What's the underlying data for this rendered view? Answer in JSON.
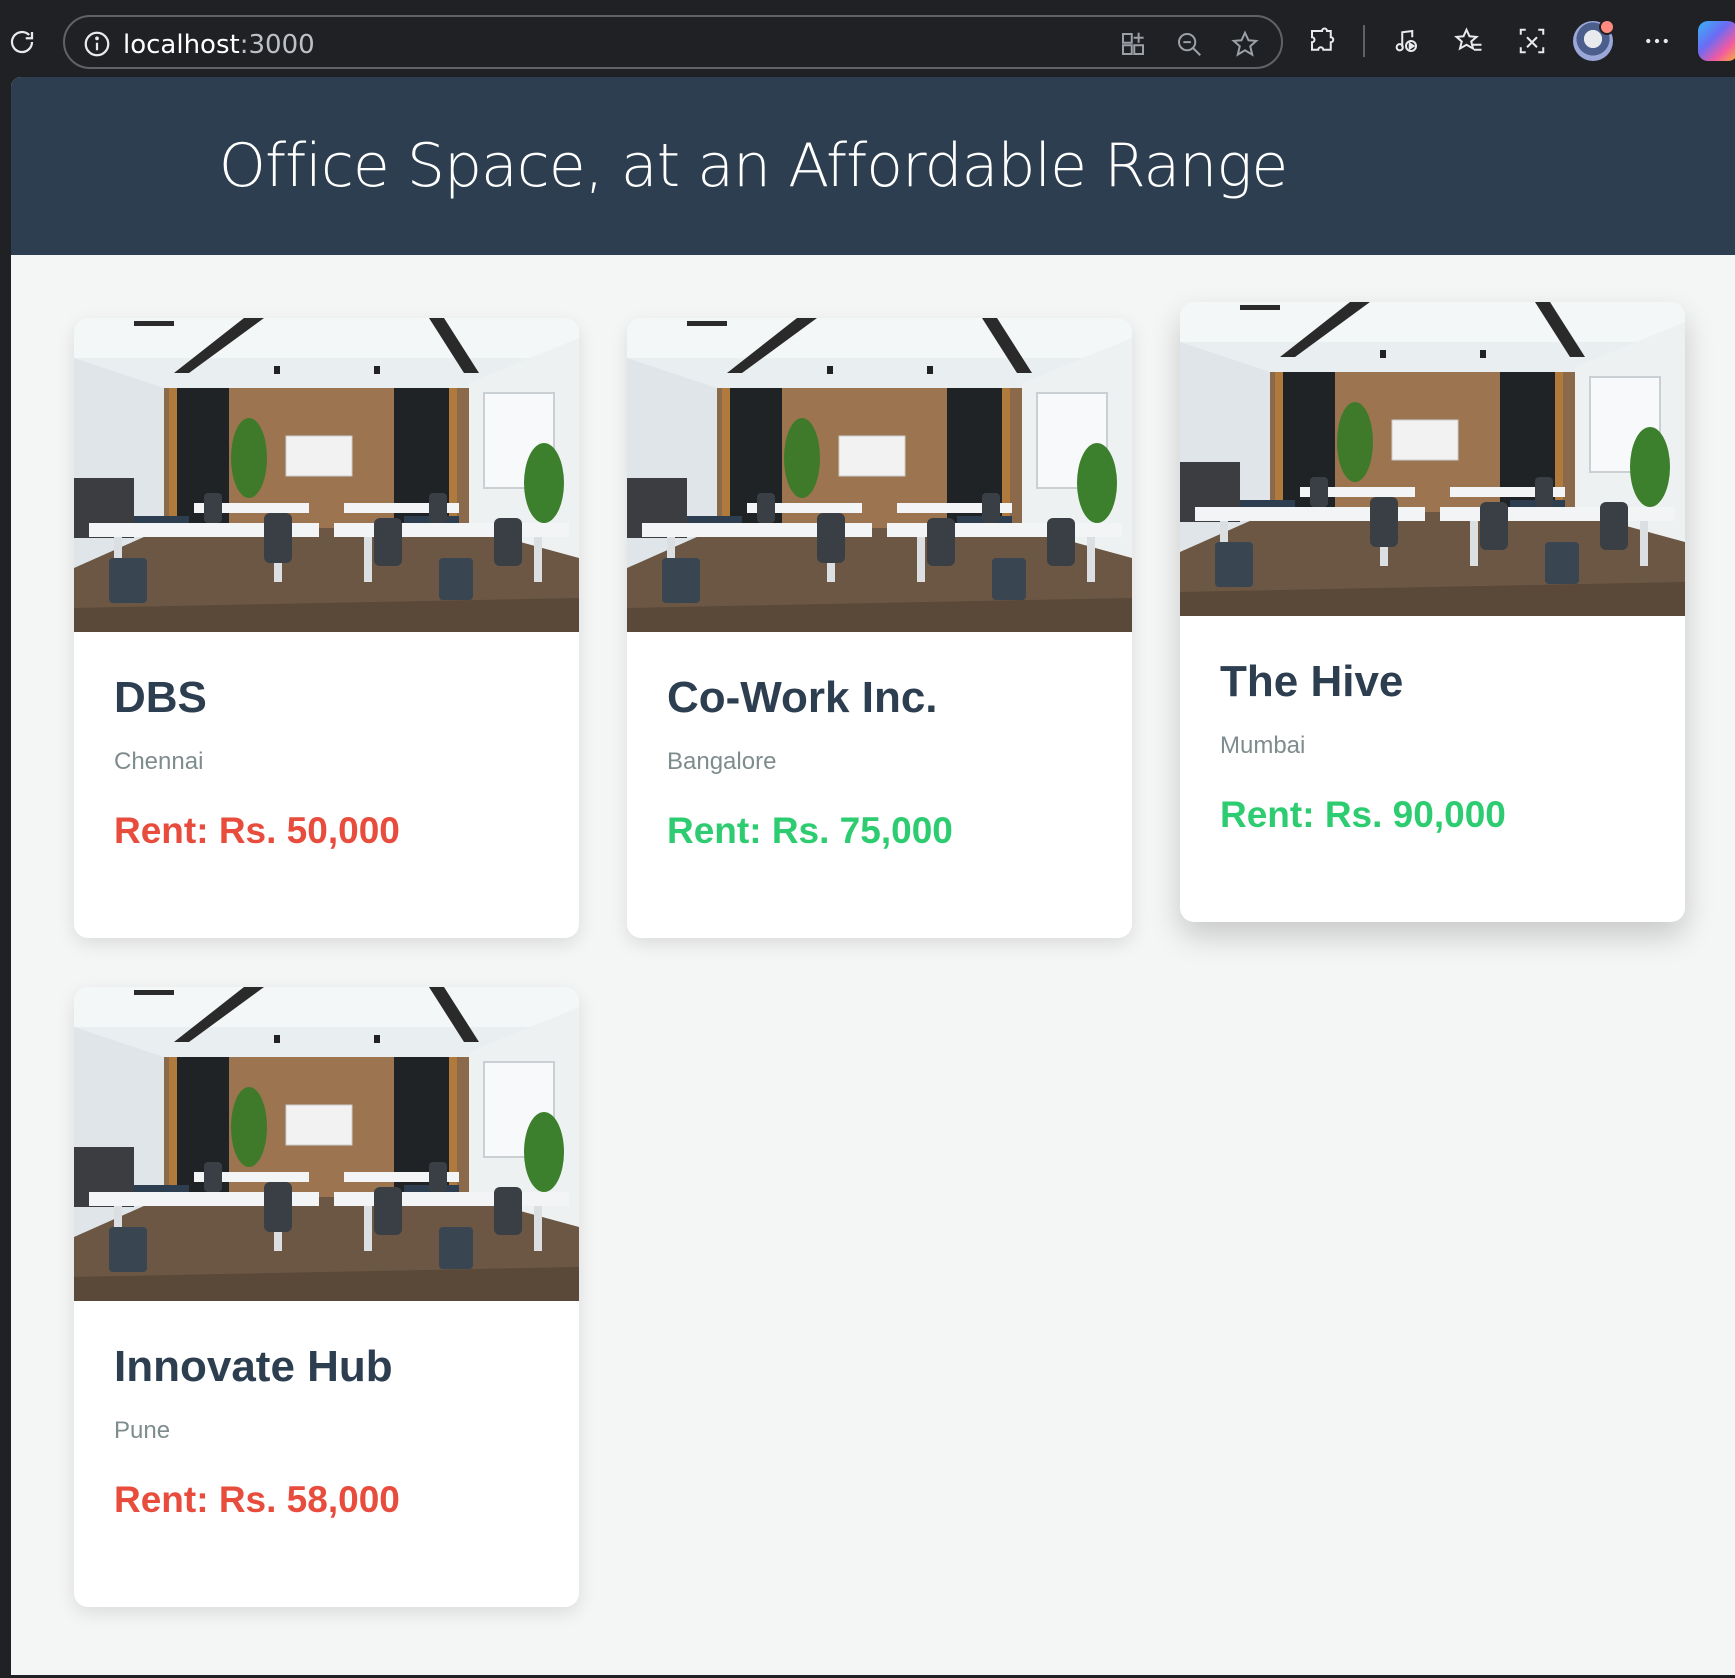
{
  "browser": {
    "url_host": "localhost",
    "url_port": ":3000",
    "icons": [
      "reload-icon",
      "site-info-icon",
      "apps-icon",
      "zoom-out-icon",
      "favorite-star-icon",
      "extensions-icon",
      "media-icon",
      "favorites-icon",
      "screenshot-icon",
      "profile-avatar",
      "more-icon",
      "copilot-icon"
    ]
  },
  "header": {
    "title": "Office Space, at an Affordable Range"
  },
  "colors": {
    "header_bg": "#2c3e50",
    "rent_high": "#27ae60",
    "rent_low": "#e74c3c",
    "name": "#2c3e50",
    "city": "#7f8c8d"
  },
  "offices": [
    {
      "name": "DBS",
      "city": "Chennai",
      "rent": "Rent: Rs. 50,000",
      "rent_color": "#e74c3c"
    },
    {
      "name": "Co-Work Inc.",
      "city": "Bangalore",
      "rent": "Rent: Rs. 75,000",
      "rent_color": "#2ecc71"
    },
    {
      "name": "The Hive",
      "city": "Mumbai",
      "rent": "Rent: Rs. 90,000",
      "rent_color": "#2ecc71"
    },
    {
      "name": "Innovate Hub",
      "city": "Pune",
      "rent": "Rent: Rs. 58,000",
      "rent_color": "#e74c3c"
    }
  ]
}
